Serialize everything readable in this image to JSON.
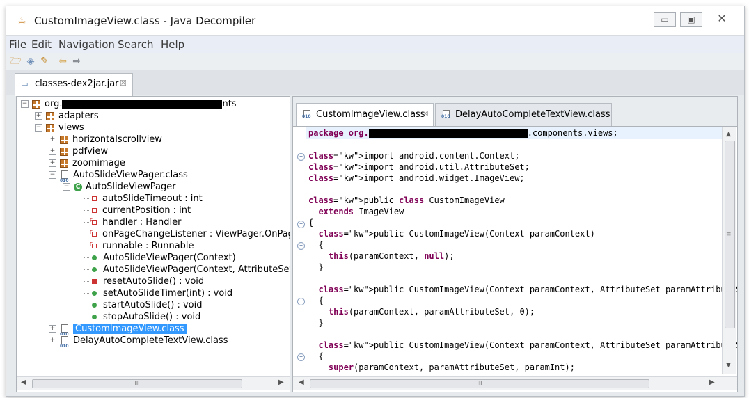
{
  "window": {
    "title": "CustomImageView.class - Java Decompiler",
    "buttons": [
      "minimize",
      "maximize",
      "close"
    ]
  },
  "menu": [
    "File",
    "Edit",
    "Navigation",
    "Search",
    "Help"
  ],
  "toolbar": {
    "icons": [
      "open-folder-icon",
      "open-type-icon",
      "wand-icon",
      "back-arrow-icon",
      "forward-arrow-icon"
    ]
  },
  "jar_tab": {
    "label": "classes-dex2jar.jar",
    "close": "☒"
  },
  "tree": {
    "root": {
      "prefix": "org.",
      "suffix": "nts"
    },
    "adapters": "adapters",
    "views": "views",
    "horizontalscrollview": "horizontalscrollview",
    "pdfview": "pdfview",
    "zoomimage": "zoomimage",
    "autoslide_file": "AutoSlideViewPager.class",
    "autoslide_class": "AutoSlideViewPager",
    "members": [
      {
        "kind": "field-private",
        "text": "autoSlideTimeout : int"
      },
      {
        "kind": "field-private",
        "text": "currentPosition : int"
      },
      {
        "kind": "field-final",
        "text": "handler : Handler"
      },
      {
        "kind": "field-final",
        "text": "onPageChangeListener : ViewPager.OnPag"
      },
      {
        "kind": "field-final",
        "text": "runnable : Runnable"
      },
      {
        "kind": "method-public",
        "text": "AutoSlideViewPager(Context)"
      },
      {
        "kind": "method-public",
        "text": "AutoSlideViewPager(Context, AttributeSet)"
      },
      {
        "kind": "method-private",
        "text": "resetAutoSlide() : void"
      },
      {
        "kind": "method-public",
        "text": "setAutoSlideTimer(int) : void"
      },
      {
        "kind": "method-public",
        "text": "startAutoSlide() : void"
      },
      {
        "kind": "method-public",
        "text": "stopAutoSlide() : void"
      }
    ],
    "customimage": "CustomImageView.class",
    "delayauto": "DelayAutoCompleteTextView.class",
    "scroll_grip": "III"
  },
  "editor": {
    "tabs": [
      {
        "label": "CustomImageView.class",
        "close": "☒",
        "active": true
      },
      {
        "label": "DelayAutoCompleteTextView.class",
        "close": "☒",
        "active": false
      }
    ],
    "package_prefix": "package org.",
    "package_suffix": ".components.views;",
    "lines": {
      "import1": "import android.content.Context;",
      "import2": "import android.util.AttributeSet;",
      "import3": "import android.widget.ImageView;",
      "class_decl": "public class CustomImageView",
      "extends": "  extends ImageView",
      "open_brace": "{",
      "ctor1": "  public CustomImageView(Context paramContext)",
      "ctor1_open": "  {",
      "ctor1_body": "    this(paramContext, null);",
      "ctor1_close": "  }",
      "ctor2": "  public CustomImageView(Context paramContext, AttributeSet paramAttributeSet)",
      "ctor2_open": "  {",
      "ctor2_body": "    this(paramContext, paramAttributeSet, 0);",
      "ctor2_close": "  }",
      "ctor3": "  public CustomImageView(Context paramContext, AttributeSet paramAttributeSet, i",
      "ctor3_open": "  {",
      "ctor3_body": "    super(paramContext, paramAttributeSet, paramInt);"
    },
    "scroll_grip": "III"
  },
  "colors": {
    "keyword": "#7f0055",
    "selection": "#3399ff",
    "package_icon": "#c77a2c",
    "class_icon": "#3ea24a",
    "private_marker": "#cc3333"
  }
}
